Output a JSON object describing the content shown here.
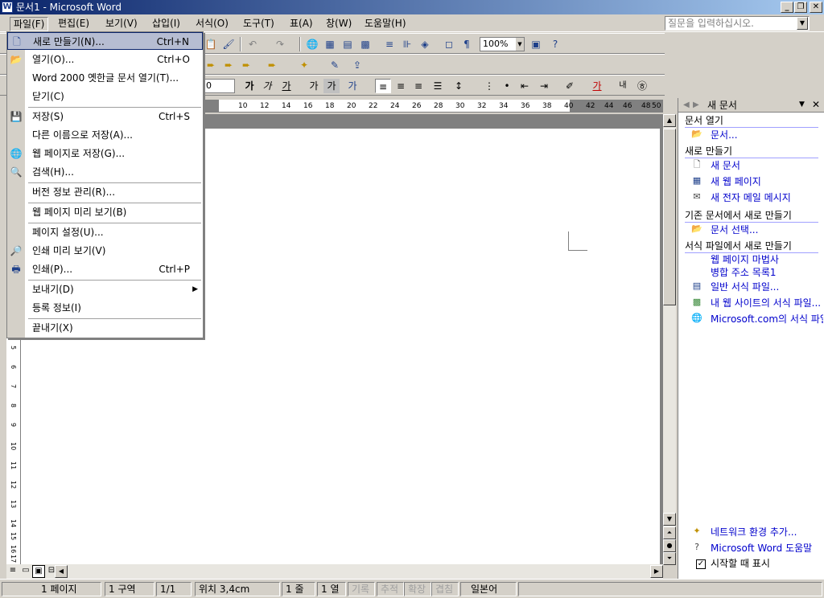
{
  "window": {
    "title": "문서1 - Microsoft Word",
    "icon": "W"
  },
  "menubar": {
    "items": [
      "파일(F)",
      "편집(E)",
      "보기(V)",
      "삽입(I)",
      "서식(O)",
      "도구(T)",
      "표(A)",
      "창(W)",
      "도움말(H)"
    ],
    "help_placeholder": "질문을 입력하십시오."
  },
  "toolbar": {
    "zoom": "100%",
    "font_size": "0"
  },
  "ruler": {
    "numbers": [
      "10",
      "12",
      "14",
      "16",
      "18",
      "20",
      "22",
      "24",
      "26",
      "28",
      "30",
      "32",
      "34",
      "36",
      "38",
      "40",
      "42",
      "44",
      "46",
      "48",
      "50"
    ]
  },
  "vruler": {
    "numbers": [
      "5",
      "6",
      "7",
      "8",
      "9",
      "10",
      "11",
      "12",
      "13",
      "14",
      "15",
      "16",
      "17"
    ]
  },
  "file_menu": {
    "items": [
      {
        "label": "새로 만들기(N)...",
        "shortcut": "Ctrl+N",
        "icon": "new-document-icon"
      },
      {
        "label": "열기(O)...",
        "shortcut": "Ctrl+O",
        "icon": "open-folder-icon"
      },
      {
        "label": "Word 2000 옛한글 문서 열기(T)...",
        "shortcut": "",
        "icon": ""
      },
      {
        "label": "닫기(C)",
        "shortcut": "",
        "icon": ""
      },
      {
        "label": "저장(S)",
        "shortcut": "Ctrl+S",
        "icon": "save-disk-icon"
      },
      {
        "label": "다른 이름으로 저장(A)...",
        "shortcut": "",
        "icon": ""
      },
      {
        "label": "웹 페이지로 저장(G)...",
        "shortcut": "",
        "icon": "web-save-icon"
      },
      {
        "label": "검색(H)...",
        "shortcut": "",
        "icon": "search-icon"
      },
      {
        "label": "버전 정보 관리(R)...",
        "shortcut": "",
        "icon": ""
      },
      {
        "label": "웹 페이지 미리 보기(B)",
        "shortcut": "",
        "icon": ""
      },
      {
        "label": "페이지 설정(U)...",
        "shortcut": "",
        "icon": ""
      },
      {
        "label": "인쇄 미리 보기(V)",
        "shortcut": "",
        "icon": "print-preview-icon"
      },
      {
        "label": "인쇄(P)...",
        "shortcut": "Ctrl+P",
        "icon": "printer-icon"
      },
      {
        "label": "보내기(D)",
        "shortcut": "",
        "icon": ""
      },
      {
        "label": "등록 정보(I)",
        "shortcut": "",
        "icon": ""
      },
      {
        "label": "끝내기(X)",
        "shortcut": "",
        "icon": ""
      }
    ]
  },
  "task_pane": {
    "title": "새 문서",
    "sections": {
      "open": "문서 열기",
      "new": "새로 만들기",
      "from_existing": "기존 문서에서 새로 만들기",
      "from_template": "서식 파일에서 새로 만들기"
    },
    "links": {
      "documents": "문서...",
      "blank_document": "새 문서",
      "blank_web_page": "새 웹 페이지",
      "blank_email": "새 전자 메일 메시지",
      "choose_document": "문서 선택...",
      "web_page_wizard": "웹 페이지 마법사",
      "mail_merge": "병합 주소 목록1",
      "general_templates": "일반 서식 파일...",
      "web_site_templates": "내 웹 사이트의 서식 파일...",
      "ms_templates": "Microsoft.com의 서식 파일",
      "add_network_place": "네트워크 환경 추가...",
      "word_help": "Microsoft Word 도움말",
      "show_at_startup": "시작할 때 표시"
    }
  },
  "statusbar": {
    "page": "1 페이지",
    "section": "1 구역",
    "page_of": "1/1",
    "position": "위치 3,4cm",
    "line": "1 줄",
    "column": "1 열",
    "rec": "기록",
    "trk": "추적",
    "ext": "확장",
    "ovr": "겹침",
    "language": "일본어"
  }
}
